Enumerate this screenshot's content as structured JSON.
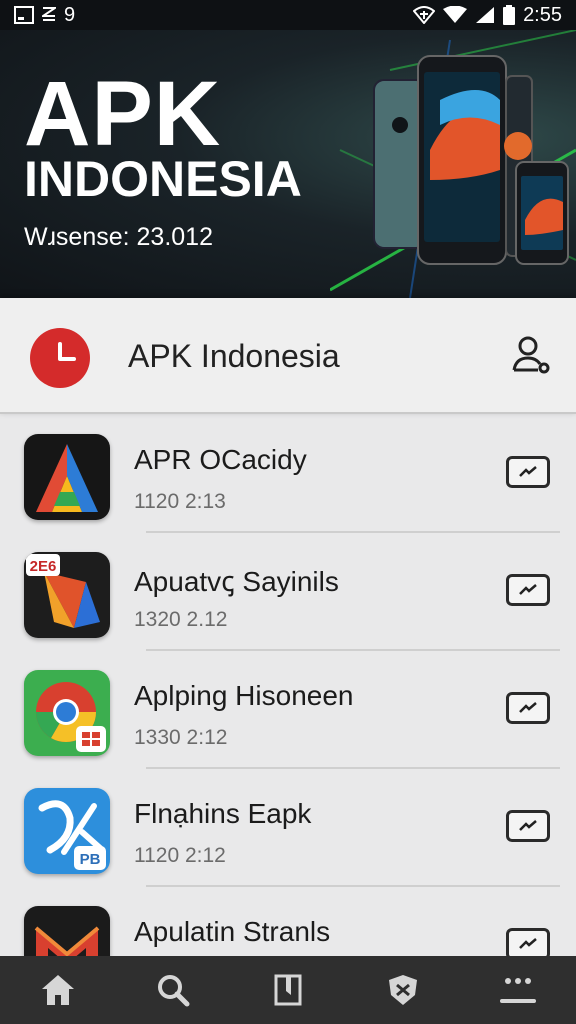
{
  "status_bar": {
    "left_icons": [
      "screenshot-icon",
      "notification-icon"
    ],
    "notification_count": "9",
    "right_icons": [
      "signal-icon",
      "wifi-icon",
      "cell-signal-icon",
      "battery-icon"
    ],
    "time": "2:55"
  },
  "hero": {
    "title": "APK",
    "subtitle": "INDONESIA",
    "version": "Wɹsense: 23.012",
    "art": "smartphones-illustration"
  },
  "header": {
    "app_name": "APK Indonesia",
    "logo_icon": "clock-logo-icon",
    "profile_icon": "user-key-icon"
  },
  "apps": [
    {
      "name": "APR OCacidy",
      "meta": "1120 2:13",
      "icon": "triangle-a-icon"
    },
    {
      "name": "Apuatvꞔ Sayinils",
      "meta": "1320 2.12",
      "icon": "folded-paper-icon",
      "badge": "2E6"
    },
    {
      "name": "Aplping Hisoneen",
      "meta": "1330 2:12",
      "icon": "chrome-style-icon"
    },
    {
      "name": "Flnạhins Eapk",
      "meta": "1120 2:12",
      "icon": "pb-scissors-icon",
      "badge": "PB"
    },
    {
      "name": "Apulatin Stranls",
      "meta": "",
      "icon": "mail-m-icon"
    }
  ],
  "bottom_nav": [
    "home-icon",
    "search-icon",
    "book-icon",
    "shield-icon",
    "menu-icon"
  ],
  "colors": {
    "accent_red": "#d42b2b",
    "nav_bg": "#2f2f2f",
    "list_bg": "#e9e9ea"
  }
}
